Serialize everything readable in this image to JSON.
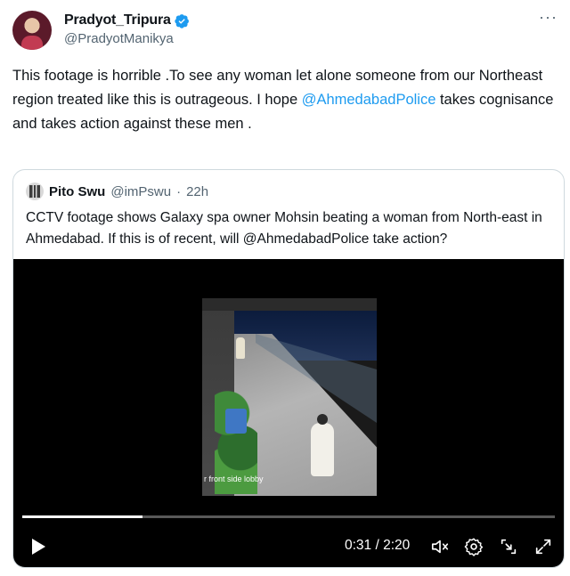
{
  "tweet": {
    "display_name": "Pradyot_Tripura",
    "handle": "@PradyotManikya",
    "verified_icon": "verified-badge-icon",
    "more_icon": "more-options-icon",
    "more_label": "···",
    "text_before": "This footage is horrible .To see any woman let alone someone from our Northeast region treated like this is outrageous. I hope ",
    "mention": "@AhmedabadPolice",
    "text_after": " takes cognisance and takes action against these men ."
  },
  "quote": {
    "display_name": "Pito Swu",
    "handle": "@imPswu",
    "separator": "·",
    "time": "22h",
    "text": "CCTV footage shows Galaxy spa owner Mohsin beating a woman from North-east in Ahmedabad. If this is of recent, will @AhmedabadPolice take action?"
  },
  "video": {
    "frame_caption": "r front side lobby",
    "progress_fraction": 0.225,
    "current_time": "0:31",
    "duration": "2:20",
    "time_display": "0:31 / 2:20",
    "icons": [
      "play-icon",
      "mute-icon",
      "settings-icon",
      "pop-out-icon",
      "fullscreen-icon"
    ],
    "colors": {
      "background": "#000000",
      "progress": "#ffffff"
    }
  },
  "colors": {
    "accent": "#1d9bf0",
    "text": "#0f1419",
    "muted": "#536471",
    "border": "#cfd9de"
  }
}
